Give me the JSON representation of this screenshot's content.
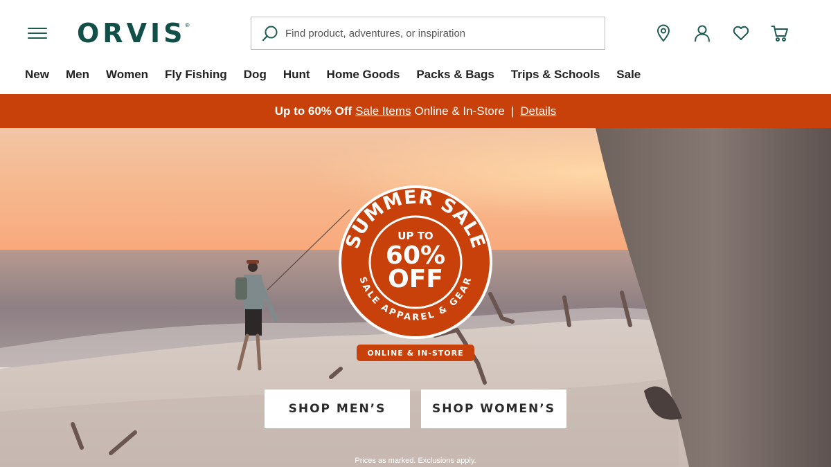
{
  "brand": {
    "logo_text": "ORVIS",
    "logo_mark": "®",
    "primary_color": "#124f49",
    "accent_color": "#c8410a"
  },
  "header": {
    "menu_icon": "hamburger-menu-icon",
    "search": {
      "placeholder": "Find product, adventures, or inspiration",
      "value": "",
      "icon": "search-icon"
    },
    "utility_icons": [
      "location-pin-icon",
      "account-icon",
      "heart-icon",
      "cart-icon"
    ]
  },
  "nav": {
    "items": [
      {
        "label": "New"
      },
      {
        "label": "Men"
      },
      {
        "label": "Women"
      },
      {
        "label": "Fly Fishing"
      },
      {
        "label": "Dog"
      },
      {
        "label": "Hunt"
      },
      {
        "label": "Home Goods"
      },
      {
        "label": "Packs & Bags"
      },
      {
        "label": "Trips & Schools"
      },
      {
        "label": "Sale"
      }
    ]
  },
  "promo": {
    "bold_text": "Up to 60% Off",
    "sale_link": "Sale Items",
    "middle_text": "Online & In-Store",
    "separator": "|",
    "details_link": "Details"
  },
  "hero": {
    "badge": {
      "arc_top": "SUMMER SALE",
      "line1": "UP TO",
      "line2": "60%",
      "line3": "OFF",
      "arc_bottom": "SALE APPAREL & GEAR"
    },
    "pill_label": "ONLINE & IN-STORE",
    "cta_men": "SHOP MEN’S",
    "cta_women": "SHOP WOMEN’S",
    "fine_print": "Prices as marked. Exclusions apply."
  }
}
